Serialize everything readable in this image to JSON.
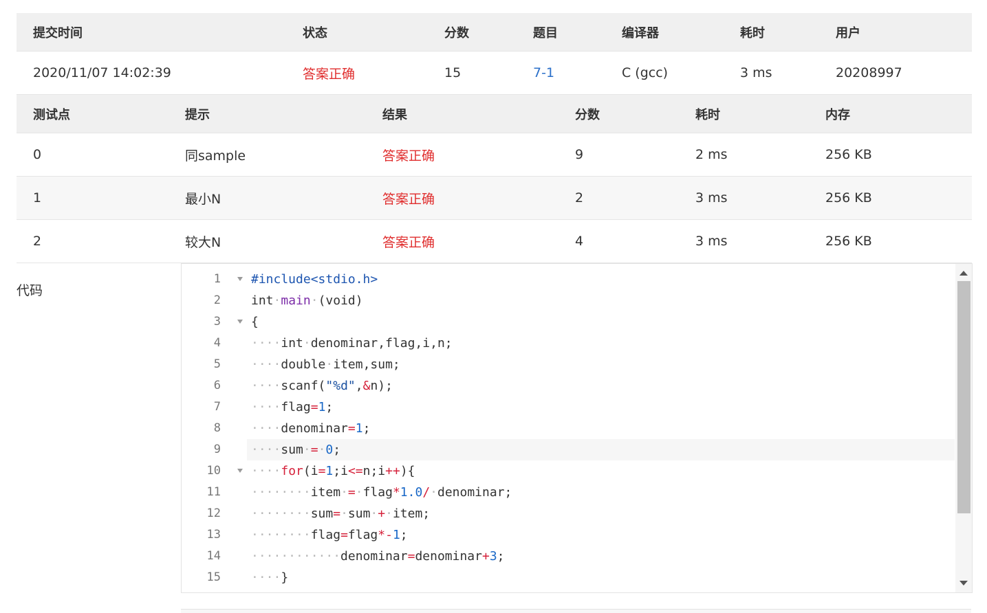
{
  "submission": {
    "headers": [
      "提交时间",
      "状态",
      "分数",
      "题目",
      "编译器",
      "耗时",
      "用户"
    ],
    "row": {
      "time": "2020/11/07 14:02:39",
      "status": "答案正确",
      "score": "15",
      "problem": "7-1",
      "compiler": "C (gcc)",
      "duration": "3 ms",
      "user": "20208997"
    }
  },
  "testcases": {
    "headers": [
      "测试点",
      "提示",
      "结果",
      "分数",
      "耗时",
      "内存"
    ],
    "rows": [
      {
        "id": "0",
        "hint": "同sample",
        "result": "答案正确",
        "score": "9",
        "duration": "2 ms",
        "memory": "256 KB"
      },
      {
        "id": "1",
        "hint": "最小N",
        "result": "答案正确",
        "score": "2",
        "duration": "3 ms",
        "memory": "256 KB"
      },
      {
        "id": "2",
        "hint": "较大N",
        "result": "答案正确",
        "score": "4",
        "duration": "3 ms",
        "memory": "256 KB"
      }
    ]
  },
  "code": {
    "label": "代码",
    "active_line": 9,
    "lines": [
      {
        "n": "1",
        "fold": true,
        "tokens": [
          [
            "pp",
            "#include<stdio.h>"
          ]
        ]
      },
      {
        "n": "2",
        "fold": false,
        "tokens": [
          [
            "t",
            "int"
          ],
          [
            "ws",
            "·"
          ],
          [
            "fn",
            "main"
          ],
          [
            "ws",
            "·"
          ],
          [
            "t",
            "(void)"
          ]
        ]
      },
      {
        "n": "3",
        "fold": true,
        "tokens": [
          [
            "t",
            "{"
          ]
        ]
      },
      {
        "n": "4",
        "fold": false,
        "tokens": [
          [
            "ws",
            "····"
          ],
          [
            "t",
            "int"
          ],
          [
            "ws",
            "·"
          ],
          [
            "t",
            "denominar,flag,i,n;"
          ]
        ]
      },
      {
        "n": "5",
        "fold": false,
        "tokens": [
          [
            "ws",
            "····"
          ],
          [
            "t",
            "double"
          ],
          [
            "ws",
            "·"
          ],
          [
            "t",
            "item,sum;"
          ]
        ]
      },
      {
        "n": "6",
        "fold": false,
        "tokens": [
          [
            "ws",
            "····"
          ],
          [
            "t",
            "scanf("
          ],
          [
            "str",
            "\"%d\""
          ],
          [
            "t",
            ","
          ],
          [
            "op",
            "&"
          ],
          [
            "t",
            "n);"
          ]
        ]
      },
      {
        "n": "7",
        "fold": false,
        "tokens": [
          [
            "ws",
            "····"
          ],
          [
            "t",
            "flag"
          ],
          [
            "op",
            "="
          ],
          [
            "num",
            "1"
          ],
          [
            "t",
            ";"
          ]
        ]
      },
      {
        "n": "8",
        "fold": false,
        "tokens": [
          [
            "ws",
            "····"
          ],
          [
            "t",
            "denominar"
          ],
          [
            "op",
            "="
          ],
          [
            "num",
            "1"
          ],
          [
            "t",
            ";"
          ]
        ]
      },
      {
        "n": "9",
        "fold": false,
        "tokens": [
          [
            "ws",
            "····"
          ],
          [
            "t",
            "sum"
          ],
          [
            "ws",
            "·"
          ],
          [
            "op",
            "="
          ],
          [
            "ws",
            "·"
          ],
          [
            "num",
            "0"
          ],
          [
            "t",
            ";"
          ]
        ]
      },
      {
        "n": "10",
        "fold": true,
        "tokens": [
          [
            "ws",
            "····"
          ],
          [
            "kw",
            "for"
          ],
          [
            "t",
            "(i"
          ],
          [
            "op",
            "="
          ],
          [
            "num",
            "1"
          ],
          [
            "t",
            ";i"
          ],
          [
            "op",
            "<="
          ],
          [
            "t",
            "n;i"
          ],
          [
            "op",
            "++"
          ],
          [
            "t",
            "){"
          ]
        ]
      },
      {
        "n": "11",
        "fold": false,
        "tokens": [
          [
            "ws",
            "········"
          ],
          [
            "t",
            "item"
          ],
          [
            "ws",
            "·"
          ],
          [
            "op",
            "="
          ],
          [
            "ws",
            "·"
          ],
          [
            "t",
            "flag"
          ],
          [
            "op",
            "*"
          ],
          [
            "num",
            "1.0"
          ],
          [
            "op",
            "/"
          ],
          [
            "ws",
            "·"
          ],
          [
            "t",
            "denominar;"
          ]
        ]
      },
      {
        "n": "12",
        "fold": false,
        "tokens": [
          [
            "ws",
            "········"
          ],
          [
            "t",
            "sum"
          ],
          [
            "op",
            "="
          ],
          [
            "ws",
            "·"
          ],
          [
            "t",
            "sum"
          ],
          [
            "ws",
            "·"
          ],
          [
            "op",
            "+"
          ],
          [
            "ws",
            "·"
          ],
          [
            "t",
            "item;"
          ]
        ]
      },
      {
        "n": "13",
        "fold": false,
        "tokens": [
          [
            "ws",
            "········"
          ],
          [
            "t",
            "flag"
          ],
          [
            "op",
            "="
          ],
          [
            "t",
            "flag"
          ],
          [
            "op",
            "*"
          ],
          [
            "op",
            "-"
          ],
          [
            "num",
            "1"
          ],
          [
            "t",
            ";"
          ]
        ]
      },
      {
        "n": "14",
        "fold": false,
        "tokens": [
          [
            "ws",
            "············"
          ],
          [
            "t",
            "denominar"
          ],
          [
            "op",
            "="
          ],
          [
            "t",
            "denominar"
          ],
          [
            "op",
            "+"
          ],
          [
            "num",
            "3"
          ],
          [
            "t",
            ";"
          ]
        ]
      },
      {
        "n": "15",
        "fold": false,
        "tokens": [
          [
            "ws",
            "····"
          ],
          [
            "t",
            "}"
          ]
        ]
      }
    ]
  }
}
